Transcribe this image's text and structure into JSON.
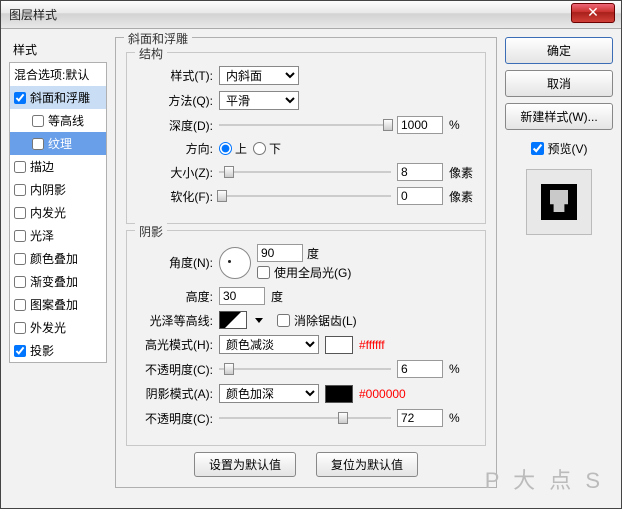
{
  "titlebar": {
    "title": "图层样式"
  },
  "sidebar": {
    "header": "样式",
    "items": [
      {
        "label": "混合选项:默认",
        "checked": null
      },
      {
        "label": "斜面和浮雕",
        "checked": true,
        "selected": false
      },
      {
        "label": "等高线",
        "checked": false,
        "sub": true
      },
      {
        "label": "纹理",
        "checked": false,
        "sub": true,
        "selected": true
      },
      {
        "label": "描边",
        "checked": false
      },
      {
        "label": "内阴影",
        "checked": false
      },
      {
        "label": "内发光",
        "checked": false
      },
      {
        "label": "光泽",
        "checked": false
      },
      {
        "label": "颜色叠加",
        "checked": false
      },
      {
        "label": "渐变叠加",
        "checked": false
      },
      {
        "label": "图案叠加",
        "checked": false
      },
      {
        "label": "外发光",
        "checked": false
      },
      {
        "label": "投影",
        "checked": true
      }
    ]
  },
  "panel": {
    "title": "斜面和浮雕",
    "structure": {
      "legend": "结构",
      "style_label": "样式(T):",
      "style_value": "内斜面",
      "method_label": "方法(Q):",
      "method_value": "平滑",
      "depth_label": "深度(D):",
      "depth_value": "1000",
      "depth_unit": "%",
      "dir_label": "方向:",
      "dir_up": "上",
      "dir_down": "下",
      "size_label": "大小(Z):",
      "size_value": "8",
      "size_unit": "像素",
      "soften_label": "软化(F):",
      "soften_value": "0",
      "soften_unit": "像素"
    },
    "shading": {
      "legend": "阴影",
      "angle_label": "角度(N):",
      "angle_value": "90",
      "angle_unit": "度",
      "global_label": "使用全局光(G)",
      "alt_label": "高度:",
      "alt_value": "30",
      "alt_unit": "度",
      "gloss_label": "光泽等高线:",
      "antialias_label": "消除锯齿(L)",
      "hi_mode_label": "高光模式(H):",
      "hi_mode_value": "颜色减淡",
      "hi_hex": "#ffffff",
      "hi_op_label": "不透明度(C):",
      "hi_op_value": "6",
      "hi_op_unit": "%",
      "sh_mode_label": "阴影模式(A):",
      "sh_mode_value": "颜色加深",
      "sh_hex": "#000000",
      "sh_op_label": "不透明度(C):",
      "sh_op_value": "72",
      "sh_op_unit": "%"
    },
    "reset_btn": "设置为默认值",
    "restore_btn": "复位为默认值"
  },
  "right": {
    "ok": "确定",
    "cancel": "取消",
    "newstyle": "新建样式(W)...",
    "preview_label": "预览(V)"
  },
  "watermark": "P 大 点 S"
}
